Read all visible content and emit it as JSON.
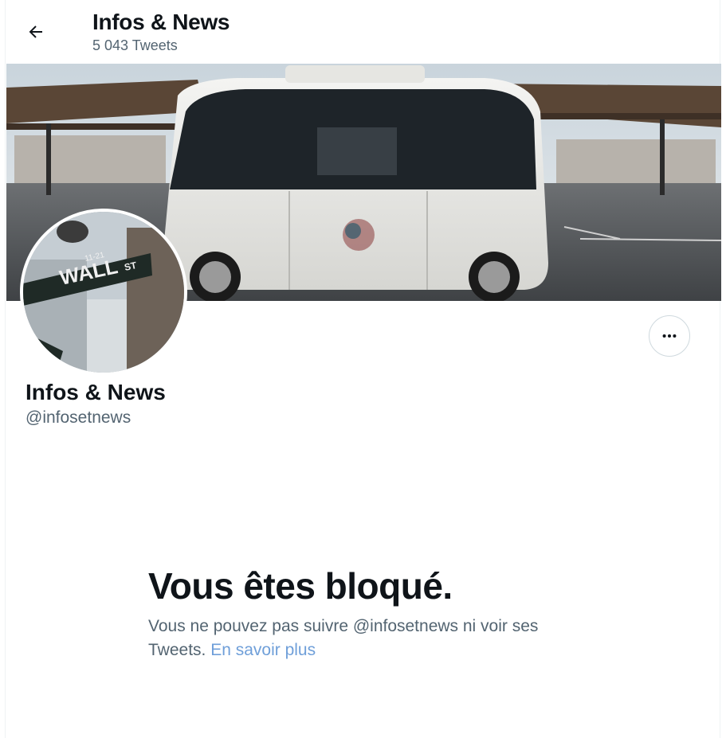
{
  "header": {
    "title": "Infos & News",
    "tweet_count": "5 043 Tweets"
  },
  "profile": {
    "name": "Infos & News",
    "handle": "@infosetnews",
    "avatar_sign_text": "WALL",
    "avatar_sign_suffix": "ST",
    "avatar_sign_number": "11-21"
  },
  "blocked": {
    "title": "Vous êtes bloqué.",
    "text": "Vous ne pouvez pas suivre @infosetnews ni voir ses Tweets.",
    "link_label": "En savoir plus"
  },
  "icons": {
    "back": "arrow-left-icon",
    "more": "more-horizontal-icon"
  },
  "colors": {
    "text_primary": "#0f1419",
    "text_secondary": "#536471",
    "link": "#6f9fd9",
    "border": "#cfd9de"
  }
}
